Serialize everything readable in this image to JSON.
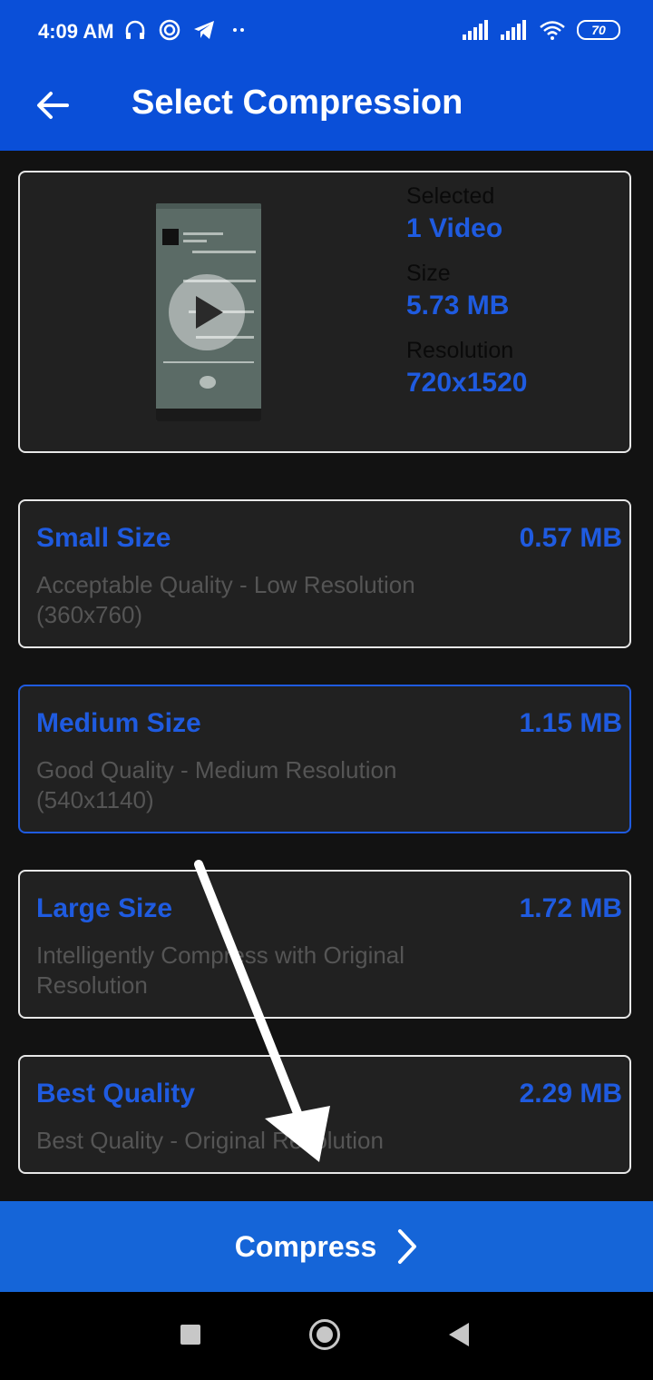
{
  "status_bar": {
    "time": "4:09 AM",
    "battery": "70",
    "icons_left": [
      "headphones-icon",
      "app-icon",
      "telegram-icon",
      "more-dots-icon"
    ],
    "icons_right": [
      "signal-icon",
      "signal-icon",
      "wifi-icon",
      "battery-icon"
    ]
  },
  "app_bar": {
    "title": "Select Compression",
    "back_icon": "arrow-left-icon"
  },
  "info": {
    "selected_label": "Selected",
    "selected_value": "1 Video",
    "size_label": "Size",
    "size_value": "5.73 MB",
    "resolution_label": "Resolution",
    "resolution_value": "720x1520"
  },
  "options": [
    {
      "title": "Small Size",
      "size": "0.57 MB",
      "description": "Acceptable Quality - Low Resolution (360x760)",
      "selected": false
    },
    {
      "title": "Medium Size",
      "size": "1.15 MB",
      "description": "Good Quality - Medium Resolution (540x1140)",
      "selected": true
    },
    {
      "title": "Large Size",
      "size": "1.72 MB",
      "description": "Intelligently Compress with Original Resolution",
      "selected": false
    },
    {
      "title": "Best Quality",
      "size": "2.29 MB",
      "description": "Best Quality - Original Resolution",
      "selected": false
    }
  ],
  "compress_button": {
    "label": "Compress"
  },
  "colors": {
    "primary": "#0a4fd8",
    "accent_text": "#1f5be0",
    "button": "#1565d8",
    "card_bg": "#212121",
    "background": "#121212"
  }
}
